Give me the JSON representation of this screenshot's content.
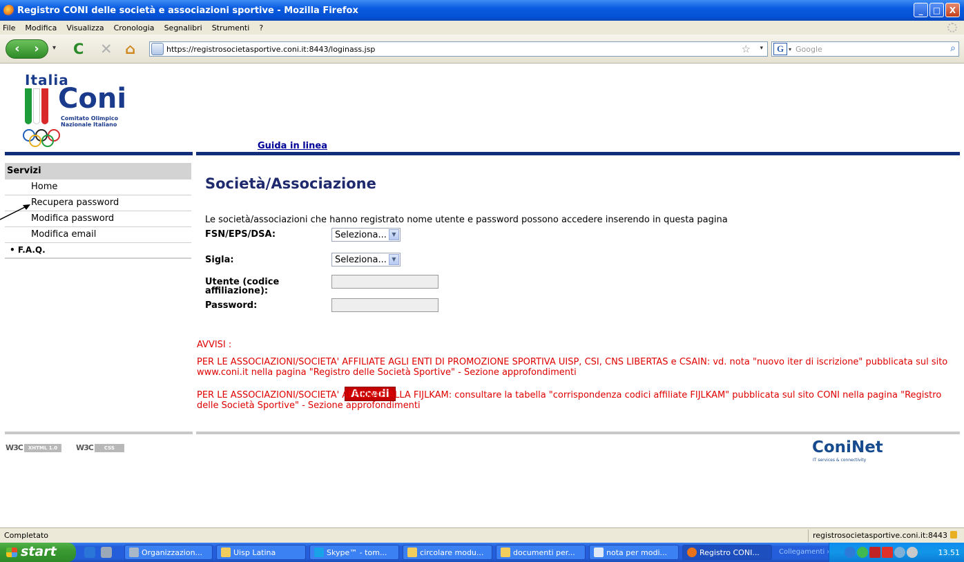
{
  "window": {
    "title": "Registro CONI delle società e associazioni sportive - Mozilla Firefox",
    "buttons": {
      "minimize": "_",
      "maximize": "□",
      "close": "X"
    }
  },
  "menu": [
    "File",
    "Modifica",
    "Visualizza",
    "Cronologia",
    "Segnalibri",
    "Strumenti",
    "?"
  ],
  "nav": {
    "back": "‹",
    "forward": "›",
    "history_dropdown": "▾",
    "reload": "C",
    "stop": "✕",
    "home": "⌂",
    "url": "https://registrosocietasportive.coni.it:8443/loginass.jsp",
    "bookmark_star": "☆",
    "url_dropdown": "▾",
    "search_engine": "G",
    "search_engine_dropdown": "▾",
    "search_placeholder": "Google",
    "search_icon": "⌕"
  },
  "logo": {
    "italia": "Italia",
    "coni": "Coni",
    "subtitle_line1": "Comitato Olimpico",
    "subtitle_line2": "Nazionale Italiano"
  },
  "guida_link": "Guida in linea",
  "sidebar": {
    "heading": "Servizi",
    "items": [
      "Home",
      "Recupera password",
      "Modifica password",
      "Modifica email"
    ],
    "faq": "• F.A.Q."
  },
  "form": {
    "heading": "Società/Associazione",
    "intro": "Le società/associazioni che hanno registrato nome utente e password possono accedere inserendo in questa pagina",
    "fsn_label": "FSN/EPS/DSA:",
    "fsn_value": "Seleziona...",
    "sigla_label": "Sigla:",
    "sigla_value": "Seleziona...",
    "utente_label": "Utente (codice affiliazione):",
    "utente_value": "",
    "password_label": "Password:",
    "password_value": "",
    "submit": "Accedi",
    "select_arrow": "▼"
  },
  "avvisi": {
    "heading": "AVVISI :",
    "notice1": "PER LE ASSOCIAZIONI/SOCIETA' AFFILIATE AGLI ENTI DI PROMOZIONE SPORTIVA UISP, CSI, CNS LIBERTAS e CSAIN: vd. nota \"nuovo iter di iscrizione\" pubblicata sul sito www.coni.it nella pagina \"Registro delle Società Sportive\" - Sezione approfondimenti",
    "notice2": "PER LE ASSOCIAZIONI/SOCIETA' AFFILIATE ALLA FIJLKAM: consultare la tabella \"corrispondenza codici affiliate FIJLKAM\" pubblicata sul sito CONI nella pagina \"Registro delle Società Sportive\" - Sezione approfondimenti"
  },
  "footer": {
    "w3c_mark": "W3C",
    "badge_xhtml": "XHTML 1.0",
    "badge_css": "CSS",
    "coninet": "ConiNet",
    "coninet_sub": "IT services & connectivity"
  },
  "status": {
    "text": "Completato",
    "host": "registrosocietasportive.coni.it:8443"
  },
  "taskbar": {
    "start": "start",
    "tasks": [
      "Organizzazion...",
      "Uisp Latina",
      "Skype™ - tom...",
      "circolare modu...",
      "documenti per...",
      "nota per modi...",
      "Registro CONI..."
    ],
    "links_label": "Collegamenti",
    "links_chevron": "»",
    "clock": "13.51"
  },
  "colors": {
    "brand_blue": "#102d7a",
    "notice_red": "#e00000",
    "button_red": "#c50000",
    "heading_blue": "#1f2a6e"
  }
}
